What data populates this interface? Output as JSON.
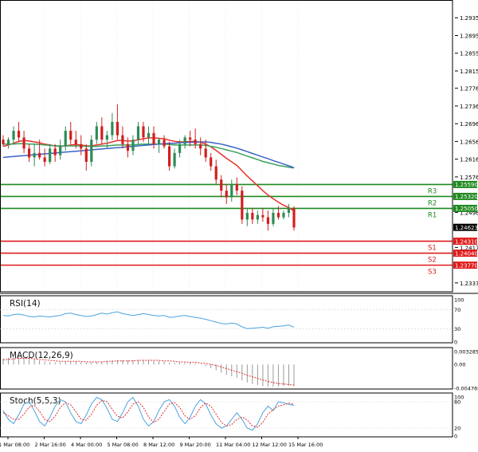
{
  "colors": {
    "background": "#ffffff",
    "grid": "#d4d4d4",
    "bull_candle": "#2e8b57",
    "bear_candle": "#d21e1e",
    "ma_fast": "#e8322a",
    "ma_mid": "#3aa05a",
    "ma_slow": "#3b63c8",
    "resistance": "#1f8a1f",
    "support": "#e01b1b",
    "last_price": "#000000",
    "indicator_line": "#4aa3df",
    "stoch_signal": "#e03030",
    "macd_signal": "#e03030",
    "macd_hist": "#9a9a9a"
  },
  "chart_data": {
    "type": "candlestick",
    "x_tick_labels": [
      "1 Mar 08:00",
      "2 Mar 16:00",
      "4 Mar 00:00",
      "5 Mar 08:00",
      "8 Mar 12:00",
      "9 Mar 20:00",
      "11 Mar 04:00",
      "12 Mar 12:00",
      "15 Mar 16:00"
    ],
    "price_axis": {
      "ticks": [
        "1.29350",
        "1.28950",
        "1.28550",
        "1.28150",
        "1.27760",
        "1.27360",
        "1.26960",
        "1.26560",
        "1.26160",
        "1.25760",
        "1.24960",
        "1.24170",
        "1.23370"
      ],
      "ylim": [
        1.2317,
        1.2975
      ]
    },
    "last_price": "1.24623",
    "resistance_levels": [
      {
        "label": "R3",
        "value": "1.25590"
      },
      {
        "label": "R2",
        "value": "1.25320"
      },
      {
        "label": "R1",
        "value": "1.25050"
      }
    ],
    "support_levels": [
      {
        "label": "S1",
        "value": "1.24310"
      },
      {
        "label": "S2",
        "value": "1.24040"
      },
      {
        "label": "S3",
        "value": "1.23770"
      }
    ],
    "candles": [
      [
        1.266,
        1.267,
        1.2645,
        1.265
      ],
      [
        1.265,
        1.2665,
        1.264,
        1.266
      ],
      [
        1.266,
        1.269,
        1.265,
        1.268
      ],
      [
        1.268,
        1.27,
        1.2655,
        1.2665
      ],
      [
        1.2665,
        1.268,
        1.263,
        1.264
      ],
      [
        1.264,
        1.265,
        1.261,
        1.262
      ],
      [
        1.262,
        1.265,
        1.26,
        1.263
      ],
      [
        1.263,
        1.266,
        1.2615,
        1.262
      ],
      [
        1.262,
        1.264,
        1.26,
        1.261
      ],
      [
        1.261,
        1.265,
        1.2605,
        1.264
      ],
      [
        1.264,
        1.265,
        1.261,
        1.2625
      ],
      [
        1.2625,
        1.266,
        1.2615,
        1.2645
      ],
      [
        1.2645,
        1.269,
        1.2635,
        1.268
      ],
      [
        1.268,
        1.27,
        1.265,
        1.266
      ],
      [
        1.266,
        1.268,
        1.264,
        1.265
      ],
      [
        1.265,
        1.267,
        1.2625,
        1.264
      ],
      [
        1.264,
        1.265,
        1.259,
        1.261
      ],
      [
        1.261,
        1.267,
        1.26,
        1.266
      ],
      [
        1.266,
        1.27,
        1.265,
        1.269
      ],
      [
        1.269,
        1.271,
        1.265,
        1.266
      ],
      [
        1.266,
        1.268,
        1.264,
        1.267
      ],
      [
        1.267,
        1.272,
        1.266,
        1.27
      ],
      [
        1.27,
        1.274,
        1.266,
        1.267
      ],
      [
        1.267,
        1.269,
        1.264,
        1.265
      ],
      [
        1.265,
        1.2665,
        1.262,
        1.2635
      ],
      [
        1.2635,
        1.267,
        1.2625,
        1.266
      ],
      [
        1.266,
        1.27,
        1.265,
        1.269
      ],
      [
        1.269,
        1.27,
        1.2655,
        1.2665
      ],
      [
        1.2665,
        1.269,
        1.265,
        1.2675
      ],
      [
        1.2675,
        1.269,
        1.264,
        1.265
      ],
      [
        1.265,
        1.2665,
        1.263,
        1.266
      ],
      [
        1.266,
        1.267,
        1.264,
        1.2645
      ],
      [
        1.2645,
        1.2655,
        1.259,
        1.26
      ],
      [
        1.26,
        1.264,
        1.2595,
        1.263
      ],
      [
        1.263,
        1.266,
        1.262,
        1.265
      ],
      [
        1.265,
        1.267,
        1.264,
        1.2665
      ],
      [
        1.2665,
        1.268,
        1.2645,
        1.266
      ],
      [
        1.266,
        1.2685,
        1.264,
        1.265
      ],
      [
        1.265,
        1.2665,
        1.2625,
        1.264
      ],
      [
        1.264,
        1.266,
        1.261,
        1.262
      ],
      [
        1.262,
        1.263,
        1.259,
        1.26
      ],
      [
        1.26,
        1.2615,
        1.256,
        1.257
      ],
      [
        1.257,
        1.258,
        1.253,
        1.2545
      ],
      [
        1.2545,
        1.256,
        1.2515,
        1.253
      ],
      [
        1.253,
        1.257,
        1.252,
        1.256
      ],
      [
        1.256,
        1.2575,
        1.2535,
        1.2545
      ],
      [
        1.2545,
        1.2555,
        1.247,
        1.248
      ],
      [
        1.248,
        1.2505,
        1.2465,
        1.2495
      ],
      [
        1.2495,
        1.2505,
        1.247,
        1.248
      ],
      [
        1.248,
        1.25,
        1.247,
        1.249
      ],
      [
        1.249,
        1.2505,
        1.2475,
        1.2485
      ],
      [
        1.2485,
        1.25,
        1.2455,
        1.247
      ],
      [
        1.247,
        1.2505,
        1.2465,
        1.2495
      ],
      [
        1.2495,
        1.251,
        1.248,
        1.2485
      ],
      [
        1.2485,
        1.25,
        1.248,
        1.2495
      ],
      [
        1.2495,
        1.2515,
        1.2485,
        1.2505
      ],
      [
        1.2505,
        1.251,
        1.2455,
        1.2462
      ]
    ],
    "moving_averages": [
      {
        "key": "ma_fast",
        "values": [
          1.2645,
          1.2648,
          1.2652,
          1.2656,
          1.2658,
          1.2657,
          1.2655,
          1.2653,
          1.265,
          1.2648,
          1.2646,
          1.2645,
          1.2646,
          1.2648,
          1.2649,
          1.2648,
          1.2646,
          1.2646,
          1.2648,
          1.265,
          1.2652,
          1.2655,
          1.2658,
          1.2658,
          1.2657,
          1.2657,
          1.266,
          1.2662,
          1.2664,
          1.2664,
          1.2663,
          1.2662,
          1.2659,
          1.2656,
          1.2655,
          1.2655,
          1.2656,
          1.2656,
          1.2654,
          1.265,
          1.2644,
          1.2636,
          1.2627,
          1.2618,
          1.261,
          1.2602,
          1.259,
          1.2578,
          1.2567,
          1.2556,
          1.2545,
          1.2535,
          1.2527,
          1.2519,
          1.2512,
          1.2507,
          1.2499
        ]
      },
      {
        "key": "ma_mid",
        "values": [
          1.265,
          1.265,
          1.265,
          1.2651,
          1.2651,
          1.265,
          1.265,
          1.2649,
          1.2648,
          1.2647,
          1.2646,
          1.2646,
          1.2646,
          1.2646,
          1.2646,
          1.2646,
          1.2645,
          1.2645,
          1.2645,
          1.2646,
          1.2646,
          1.2647,
          1.2648,
          1.2648,
          1.2648,
          1.2648,
          1.2649,
          1.265,
          1.265,
          1.265,
          1.265,
          1.265,
          1.2649,
          1.2648,
          1.2648,
          1.2648,
          1.2648,
          1.2648,
          1.2648,
          1.2647,
          1.2645,
          1.2643,
          1.264,
          1.2637,
          1.2634,
          1.2631,
          1.2627,
          1.2623,
          1.2619,
          1.2615,
          1.2611,
          1.2608,
          1.2605,
          1.2602,
          1.26,
          1.2598,
          1.2596
        ]
      },
      {
        "key": "ma_slow",
        "values": [
          1.262,
          1.2621,
          1.2622,
          1.2623,
          1.2624,
          1.2625,
          1.2626,
          1.2627,
          1.2628,
          1.2629,
          1.263,
          1.2631,
          1.2632,
          1.2633,
          1.2634,
          1.2635,
          1.2636,
          1.2637,
          1.2638,
          1.2639,
          1.264,
          1.2641,
          1.2642,
          1.2643,
          1.2644,
          1.2645,
          1.2646,
          1.2647,
          1.2648,
          1.2649,
          1.265,
          1.2651,
          1.2652,
          1.2652,
          1.2653,
          1.2654,
          1.2654,
          1.2655,
          1.2655,
          1.2655,
          1.2654,
          1.2652,
          1.265,
          1.2647,
          1.2644,
          1.2641,
          1.2637,
          1.2633,
          1.2629,
          1.2625,
          1.2621,
          1.2617,
          1.2613,
          1.2609,
          1.2605,
          1.2601,
          1.2597
        ]
      }
    ],
    "rsi": {
      "label": "RSI(14)",
      "ticks": [
        "100",
        "70",
        "30",
        "0"
      ],
      "ylim": [
        0,
        100
      ],
      "values": [
        58,
        57,
        60,
        61,
        59,
        56,
        55,
        57,
        56,
        55,
        57,
        58,
        62,
        63,
        60,
        58,
        56,
        57,
        60,
        63,
        61,
        64,
        66,
        62,
        60,
        58,
        60,
        62,
        60,
        58,
        57,
        58,
        54,
        55,
        57,
        58,
        56,
        54,
        52,
        50,
        47,
        44,
        41,
        40,
        42,
        40,
        34,
        30,
        31,
        32,
        33,
        31,
        34,
        35,
        36,
        38,
        33
      ]
    },
    "macd": {
      "label": "MACD(12,26,9)",
      "ticks": [
        "0.003285",
        "0.00",
        "-0.004769"
      ],
      "ylim": [
        -0.004769,
        0.003285
      ],
      "histogram": [
        0.0012,
        0.0013,
        0.0014,
        0.0015,
        0.0014,
        0.0012,
        0.001,
        0.0008,
        0.0006,
        0.0005,
        0.0004,
        0.0004,
        0.0005,
        0.0006,
        0.0006,
        0.0005,
        0.0004,
        0.0004,
        0.0005,
        0.0006,
        0.0007,
        0.0008,
        0.0009,
        0.0009,
        0.0008,
        0.0008,
        0.0009,
        0.0009,
        0.0009,
        0.0008,
        0.0007,
        0.0006,
        0.0004,
        0.0003,
        0.0003,
        0.0003,
        0.0003,
        0.0002,
        0.0,
        -0.0003,
        -0.0007,
        -0.0011,
        -0.0016,
        -0.002,
        -0.0023,
        -0.0026,
        -0.0031,
        -0.0035,
        -0.0038,
        -0.004,
        -0.0042,
        -0.0043,
        -0.0043,
        -0.0043,
        -0.0042,
        -0.0041,
        -0.0042
      ],
      "signal": [
        0.0009,
        0.001,
        0.0011,
        0.0012,
        0.0012,
        0.0012,
        0.0011,
        0.001,
        0.0009,
        0.0008,
        0.0007,
        0.0006,
        0.0006,
        0.0006,
        0.0006,
        0.0006,
        0.0005,
        0.0005,
        0.0005,
        0.0005,
        0.0006,
        0.0006,
        0.0007,
        0.0007,
        0.0007,
        0.0007,
        0.0008,
        0.0008,
        0.0008,
        0.0008,
        0.0008,
        0.0007,
        0.0007,
        0.0006,
        0.0005,
        0.0005,
        0.0004,
        0.0004,
        0.0003,
        0.0002,
        0.0,
        -0.0002,
        -0.0005,
        -0.0008,
        -0.0011,
        -0.0014,
        -0.0017,
        -0.0021,
        -0.0024,
        -0.0027,
        -0.003,
        -0.0033,
        -0.0035,
        -0.0037,
        -0.0038,
        -0.0039,
        -0.004
      ]
    },
    "stoch": {
      "label": "Stoch(5,5,3)",
      "ticks": [
        "100",
        "80",
        "20",
        "0"
      ],
      "ylim": [
        0,
        100
      ],
      "k": [
        60,
        40,
        30,
        50,
        75,
        80,
        60,
        35,
        25,
        45,
        70,
        85,
        80,
        55,
        35,
        30,
        50,
        75,
        90,
        85,
        65,
        40,
        35,
        55,
        80,
        90,
        70,
        40,
        25,
        35,
        60,
        80,
        85,
        70,
        45,
        30,
        45,
        70,
        85,
        75,
        50,
        30,
        20,
        25,
        40,
        55,
        40,
        20,
        15,
        30,
        55,
        70,
        60,
        80,
        78,
        74,
        72
      ],
      "d": [
        55,
        48,
        40,
        40,
        52,
        68,
        72,
        58,
        40,
        35,
        47,
        67,
        78,
        73,
        57,
        40,
        38,
        52,
        72,
        83,
        80,
        63,
        47,
        43,
        57,
        75,
        80,
        67,
        45,
        33,
        40,
        58,
        75,
        78,
        67,
        48,
        40,
        48,
        67,
        77,
        70,
        52,
        33,
        25,
        28,
        40,
        45,
        38,
        25,
        22,
        33,
        52,
        62,
        70,
        73,
        77,
        74
      ]
    }
  }
}
